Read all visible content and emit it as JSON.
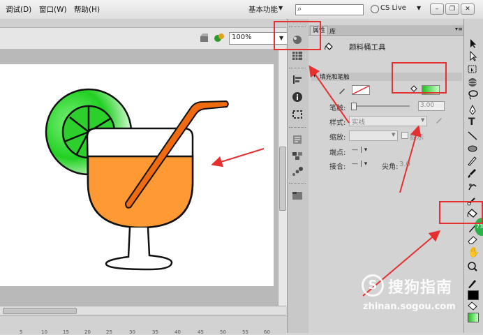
{
  "menus": [
    "调试(D)",
    "窗口(W)",
    "帮助(H)"
  ],
  "workspace": "基本功能",
  "search": {
    "value": "",
    "placeholder": ""
  },
  "cs_live": "CS Live",
  "zoom": "100%",
  "panel": {
    "tabs": [
      "属性",
      "库"
    ],
    "tool_name": "颜料桶工具",
    "section": "填充和笔触",
    "stroke_width_label": "笔触:",
    "stroke_width_value": "3.00",
    "style_label": "样式:",
    "style_value": "实线",
    "scale_label": "缩放:",
    "hint_label": "提示",
    "cap_label": "端点:",
    "join_label": "接合:",
    "miter_label": "尖角:",
    "miter_value": "3.0"
  },
  "ruler": [
    "5",
    "10",
    "15",
    "20",
    "25",
    "30",
    "35",
    "40",
    "45",
    "50",
    "55",
    "60"
  ],
  "badge": "73",
  "watermark": {
    "logo": "S",
    "text": "搜狗指南",
    "url": "zhinan.sogou.com"
  },
  "colors": {
    "fill_green": "#20c020",
    "juice_orange": "#ff9933",
    "straw_orange": "#f06a10",
    "annotation_red": "#e53030"
  },
  "icons": [
    "search-icon",
    "paint-bucket-icon",
    "pencil-icon",
    "arrow-tool-icon",
    "hand-icon",
    "zoom-icon"
  ]
}
